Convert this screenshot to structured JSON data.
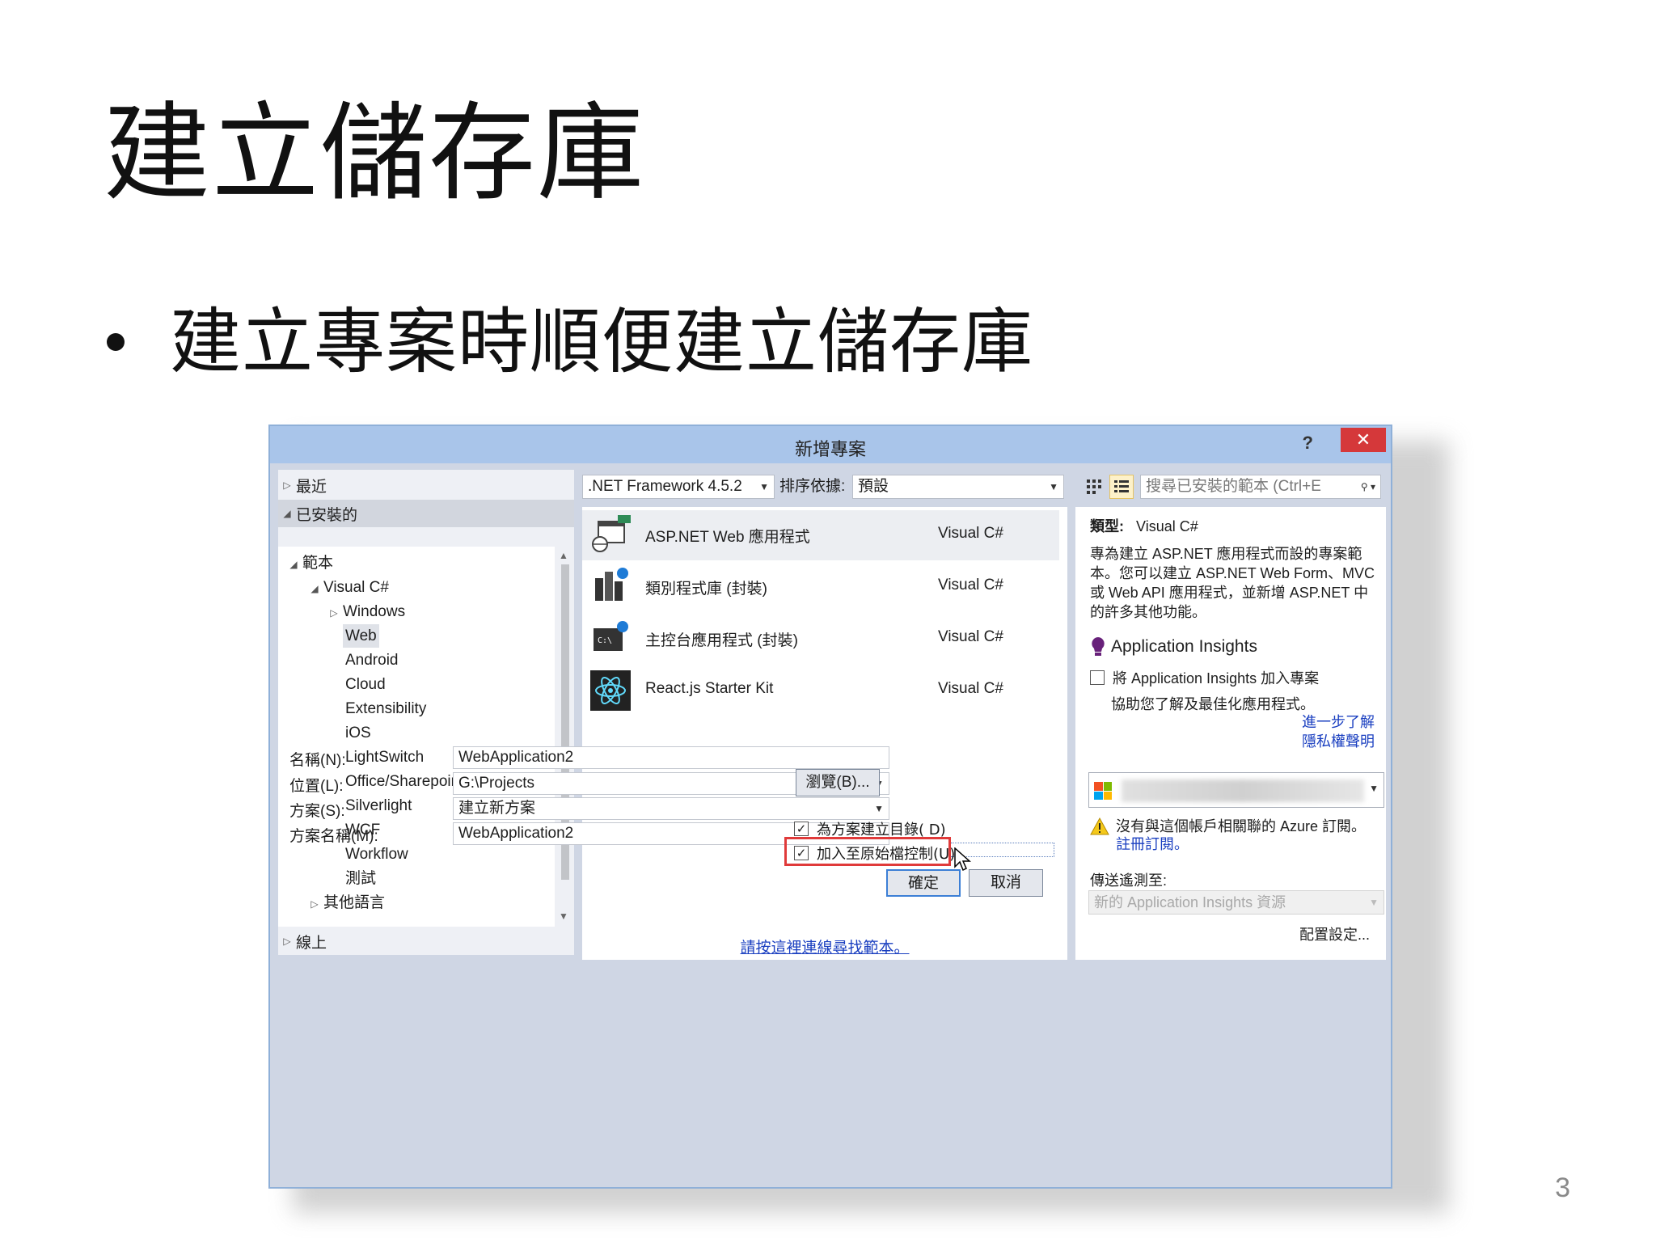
{
  "slide": {
    "title": "建立儲存庫",
    "bullet": "建立專案時順便建立儲存庫",
    "page_number": "3"
  },
  "dialog": {
    "title": "新增專案",
    "help": "?",
    "close": "✕",
    "nav": {
      "recent": "最近",
      "installed": "已安裝的",
      "templates": "範本",
      "visual_csharp": "Visual C#",
      "windows": "Windows",
      "items": [
        "Web",
        "Android",
        "Cloud",
        "Extensibility",
        "iOS",
        "LightSwitch",
        "Office/Sharepoint",
        "Silverlight",
        "WCF",
        "Workflow",
        "測試"
      ],
      "other_languages": "其他語言",
      "online": "線上"
    },
    "toolbar": {
      "framework": ".NET Framework 4.5.2",
      "sort_label": "排序依據:",
      "sort_value": "預設",
      "search_placeholder": "搜尋已安裝的範本 (Ctrl+E"
    },
    "templates": [
      {
        "name": "ASP.NET Web 應用程式",
        "lang": "Visual C#"
      },
      {
        "name": "類別程式庫 (封裝)",
        "lang": "Visual C#"
      },
      {
        "name": "主控台應用程式 (封裝)",
        "lang": "Visual C#"
      },
      {
        "name": "React.js Starter Kit",
        "lang": "Visual C#"
      }
    ],
    "online_link": "請按這裡連線尋找範本。",
    "info": {
      "type_label": "類型:",
      "type_value": "Visual C#",
      "description": "專為建立 ASP.NET 應用程式而設的專案範本。您可以建立 ASP.NET Web Form、MVC 或 Web API 應用程式，並新增 ASP.NET 中的許多其他功能。",
      "ai_title": "Application Insights",
      "ai_checkbox": "將 Application Insights 加入專案",
      "ai_help": "協助您了解及最佳化應用程式。",
      "learn_more": "進一步了解",
      "privacy": "隱私權聲明",
      "warning": "沒有與這個帳戶相關聯的 Azure 訂閱。",
      "register": "註冊訂閱。",
      "send_label": "傳送遙測至:",
      "ai_resource": "新的 Application Insights 資源",
      "config": "配置設定..."
    },
    "form": {
      "name_label": "名稱(N):",
      "name_value": "WebApplication2",
      "location_label": "位置(L):",
      "location_value": "G:\\Projects",
      "solution_label": "方案(S):",
      "solution_value": "建立新方案",
      "solution_name_label": "方案名稱(M):",
      "solution_name_value": "WebApplication2",
      "browse": "瀏覽(B)...",
      "create_dir": "為方案建立目錄( D)",
      "add_source_control": "加入至原始檔控制(U)",
      "ok": "確定",
      "cancel": "取消"
    },
    "colors": {
      "highlight": "#e03a3a",
      "titlebar": "#a9c5ea",
      "close": "#d5383a"
    }
  }
}
